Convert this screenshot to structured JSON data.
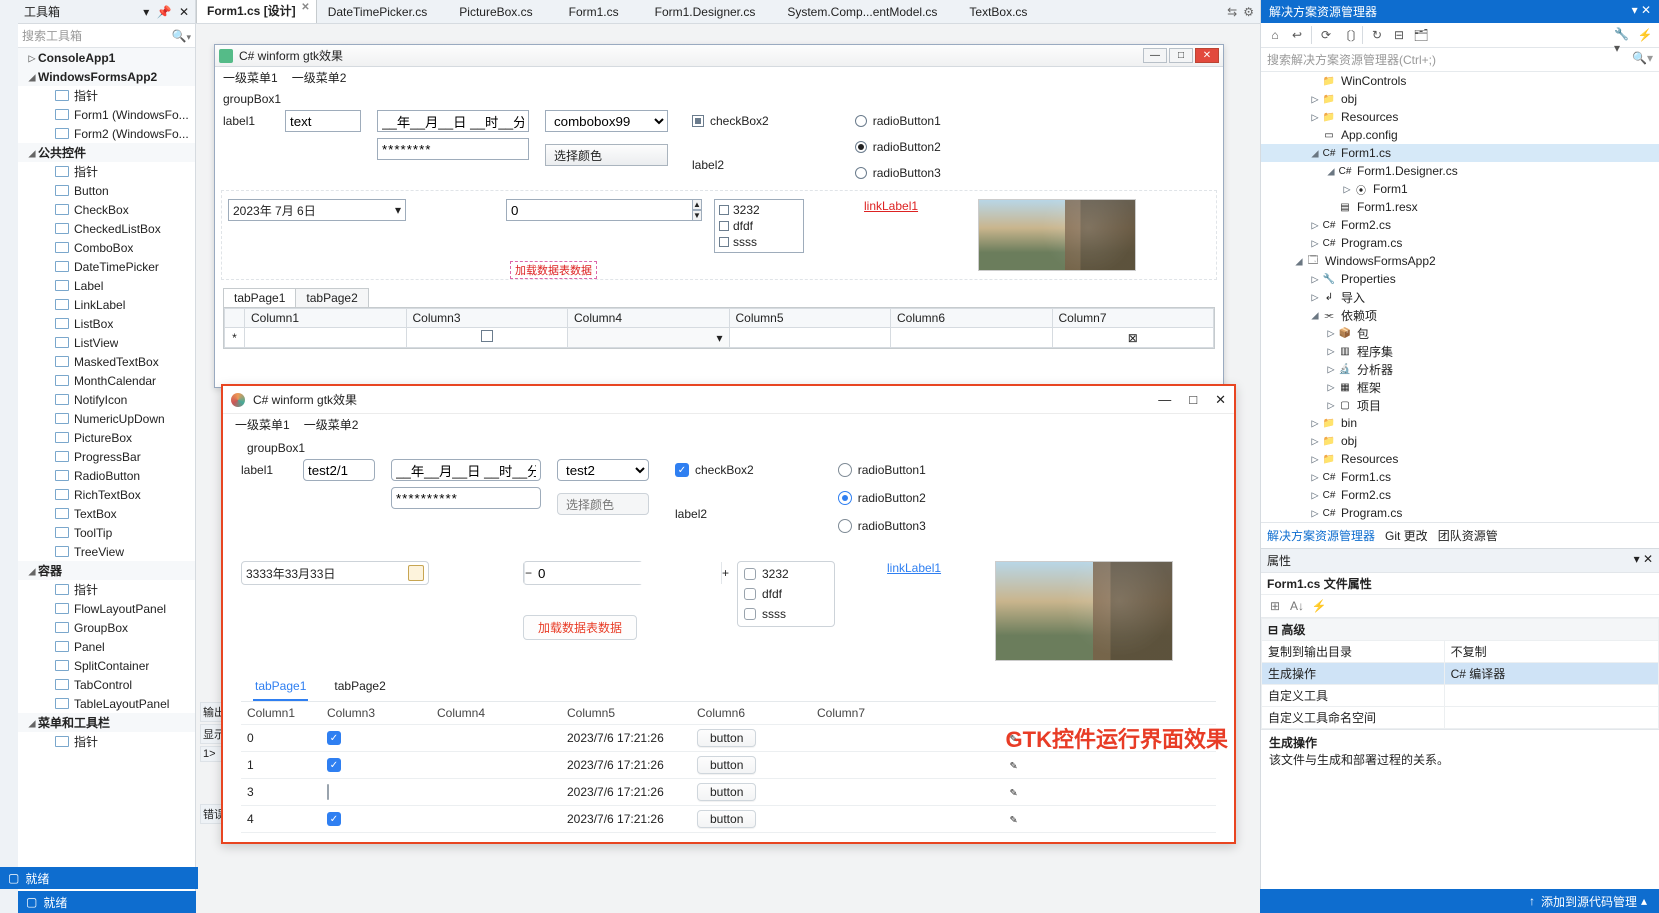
{
  "toolbox": {
    "title": "工具箱",
    "search_placeholder": "搜索工具箱",
    "groups": [
      {
        "header": "ConsoleApp1",
        "expander": "▷",
        "items": []
      },
      {
        "header": "WindowsFormsApp2",
        "expander": "◢",
        "items": [
          {
            "label": "指针",
            "key": "pointer"
          },
          {
            "label": "Form1 (WindowsFo...",
            "key": "form1"
          },
          {
            "label": "Form2 (WindowsFo...",
            "key": "form2"
          }
        ]
      },
      {
        "header": "公共控件",
        "expander": "◢",
        "selected": true,
        "items": [
          {
            "label": "指针"
          },
          {
            "label": "Button"
          },
          {
            "label": "CheckBox"
          },
          {
            "label": "CheckedListBox"
          },
          {
            "label": "ComboBox"
          },
          {
            "label": "DateTimePicker"
          },
          {
            "label": "Label"
          },
          {
            "label": "LinkLabel"
          },
          {
            "label": "ListBox"
          },
          {
            "label": "ListView"
          },
          {
            "label": "MaskedTextBox"
          },
          {
            "label": "MonthCalendar"
          },
          {
            "label": "NotifyIcon"
          },
          {
            "label": "NumericUpDown"
          },
          {
            "label": "PictureBox"
          },
          {
            "label": "ProgressBar"
          },
          {
            "label": "RadioButton"
          },
          {
            "label": "RichTextBox"
          },
          {
            "label": "TextBox"
          },
          {
            "label": "ToolTip"
          },
          {
            "label": "TreeView"
          }
        ]
      },
      {
        "header": "容器",
        "expander": "◢",
        "items": [
          {
            "label": "指针"
          },
          {
            "label": "FlowLayoutPanel"
          },
          {
            "label": "GroupBox"
          },
          {
            "label": "Panel"
          },
          {
            "label": "SplitContainer"
          },
          {
            "label": "TabControl"
          },
          {
            "label": "TableLayoutPanel"
          }
        ]
      },
      {
        "header": "菜单和工具栏",
        "expander": "◢",
        "items": [
          {
            "label": "指针"
          }
        ]
      }
    ]
  },
  "docTabs": [
    {
      "label": "Form1.cs [设计]",
      "active": true,
      "dirty": true
    },
    {
      "label": "DateTimePicker.cs"
    },
    {
      "label": "PictureBox.cs"
    },
    {
      "label": "Form1.cs"
    },
    {
      "label": "Form1.Designer.cs"
    },
    {
      "label": "System.Comp...entModel.cs"
    },
    {
      "label": "TextBox.cs"
    }
  ],
  "designer": {
    "windowTitle": "C# winform gtk效果",
    "menu": [
      "一级菜单1",
      "一级菜单2"
    ],
    "groupboxLabel": "groupBox1",
    "label1": "label1",
    "text1_value": "text",
    "datemask": "__年__月__日 __时__分",
    "password_mask": "********",
    "combo_value": "combobox99",
    "checkbox2": "checkBox2",
    "btn_color": "选择颜色",
    "label2": "label2",
    "radios": [
      "radioButton1",
      "radioButton2",
      "radioButton3"
    ],
    "radio_selected": 1,
    "datepicker_value": "2023年  7月  6日",
    "numeric_value": "0",
    "checklist": [
      "3232",
      "dfdf",
      "ssss"
    ],
    "linklabel": "linkLabel1",
    "red_overflow": "加载数据表数据",
    "tabs": [
      "tabPage1",
      "tabPage2"
    ],
    "grid_cols": [
      "Column1",
      "Column3",
      "Column4",
      "Column5",
      "Column6",
      "Column7"
    ],
    "grid_rowmarker": "*"
  },
  "gtk": {
    "windowTitle": "C# winform gtk效果",
    "menu": [
      "一级菜单1",
      "一级菜单2"
    ],
    "groupboxLabel": "groupBox1",
    "label1": "label1",
    "text1_value": "test2/1",
    "datemask": "__年__月__日 __时__分",
    "password_mask": "**********",
    "combo_value": "test2",
    "checkbox2": "checkBox2",
    "btn_color": "选择颜色",
    "label2": "label2",
    "radios": [
      "radioButton1",
      "radioButton2",
      "radioButton3"
    ],
    "radio_selected": 1,
    "datepicker_value": "3333年33月33日",
    "numeric_value": "0",
    "btn_load": "加载数据表数据",
    "checklist": [
      "3232",
      "dfdf",
      "ssss"
    ],
    "linklabel": "linkLabel1",
    "tabs": [
      "tabPage1",
      "tabPage2"
    ],
    "grid_cols": [
      "Column1",
      "Column3",
      "Column4",
      "Column5",
      "Column6",
      "Column7"
    ],
    "grid_rows": [
      {
        "c1": "0",
        "c3": true,
        "c4": "",
        "c5": "2023/7/6 17:21:26",
        "c6": "button"
      },
      {
        "c1": "1",
        "c3": true,
        "c4": "",
        "c5": "2023/7/6 17:21:26",
        "c6": "button"
      },
      {
        "c1": "3",
        "c3": false,
        "c4": "",
        "c5": "2023/7/6 17:21:26",
        "c6": "button"
      },
      {
        "c1": "4",
        "c3": true,
        "c4": "",
        "c5": "2023/7/6 17:21:26",
        "c6": "button"
      }
    ]
  },
  "red_annotation": "GTK控件运行界面效果",
  "output": {
    "title": "输出",
    "show": "显示",
    "rows": "1>",
    "err": "错误"
  },
  "solution": {
    "title": "解决方案资源管理器",
    "search_placeholder": "搜索解决方案资源管理器(Ctrl+;)",
    "tree": [
      {
        "d": 3,
        "exp": "",
        "ic": "folder",
        "label": "WinControls"
      },
      {
        "d": 3,
        "exp": "▷",
        "ic": "folder",
        "label": "obj"
      },
      {
        "d": 3,
        "exp": "▷",
        "ic": "folder",
        "label": "Resources"
      },
      {
        "d": 3,
        "exp": "",
        "ic": "file",
        "label": "App.config"
      },
      {
        "d": 3,
        "exp": "◢",
        "ic": "cs",
        "label": "Form1.cs",
        "sel": true
      },
      {
        "d": 4,
        "exp": "◢",
        "ic": "cs",
        "label": "Form1.Designer.cs"
      },
      {
        "d": 5,
        "exp": "▷",
        "ic": "class",
        "label": "Form1"
      },
      {
        "d": 4,
        "exp": "",
        "ic": "resx",
        "label": "Form1.resx"
      },
      {
        "d": 3,
        "exp": "▷",
        "ic": "cs",
        "label": "Form2.cs"
      },
      {
        "d": 3,
        "exp": "▷",
        "ic": "cs",
        "label": "Program.cs"
      },
      {
        "d": 2,
        "exp": "◢",
        "ic": "proj",
        "label": "WindowsFormsApp2"
      },
      {
        "d": 3,
        "exp": "▷",
        "ic": "prop",
        "label": "Properties"
      },
      {
        "d": 3,
        "exp": "▷",
        "ic": "import",
        "label": "导入"
      },
      {
        "d": 3,
        "exp": "◢",
        "ic": "dep",
        "label": "依赖项"
      },
      {
        "d": 4,
        "exp": "▷",
        "ic": "pkg",
        "label": "包"
      },
      {
        "d": 4,
        "exp": "▷",
        "ic": "asm",
        "label": "程序集"
      },
      {
        "d": 4,
        "exp": "▷",
        "ic": "ana",
        "label": "分析器"
      },
      {
        "d": 4,
        "exp": "▷",
        "ic": "frm",
        "label": "框架"
      },
      {
        "d": 4,
        "exp": "▷",
        "ic": "prj",
        "label": "项目"
      },
      {
        "d": 3,
        "exp": "▷",
        "ic": "folder",
        "label": "bin"
      },
      {
        "d": 3,
        "exp": "▷",
        "ic": "folder",
        "label": "obj"
      },
      {
        "d": 3,
        "exp": "▷",
        "ic": "folder",
        "label": "Resources"
      },
      {
        "d": 3,
        "exp": "▷",
        "ic": "cs",
        "label": "Form1.cs"
      },
      {
        "d": 3,
        "exp": "▷",
        "ic": "cs",
        "label": "Form2.cs"
      },
      {
        "d": 3,
        "exp": "▷",
        "ic": "cs",
        "label": "Program.cs"
      }
    ],
    "tabs": [
      "解决方案资源管理器",
      "Git 更改",
      "团队资源管"
    ]
  },
  "props": {
    "title": "属性",
    "object": "Form1.cs 文件属性",
    "cat_adv": "高级",
    "rows": [
      {
        "k": "复制到输出目录",
        "v": "不复制"
      },
      {
        "k": "生成操作",
        "v": "C# 编译器",
        "sel": true
      },
      {
        "k": "自定义工具",
        "v": ""
      },
      {
        "k": "自定义工具命名空间",
        "v": ""
      }
    ],
    "cat_build": "生成操作",
    "desc_title": "生成操作",
    "desc_body": "该文件与生成和部署过程的关系。"
  },
  "status": {
    "ready": "就绪",
    "add_source": "添加到源代码管理"
  }
}
